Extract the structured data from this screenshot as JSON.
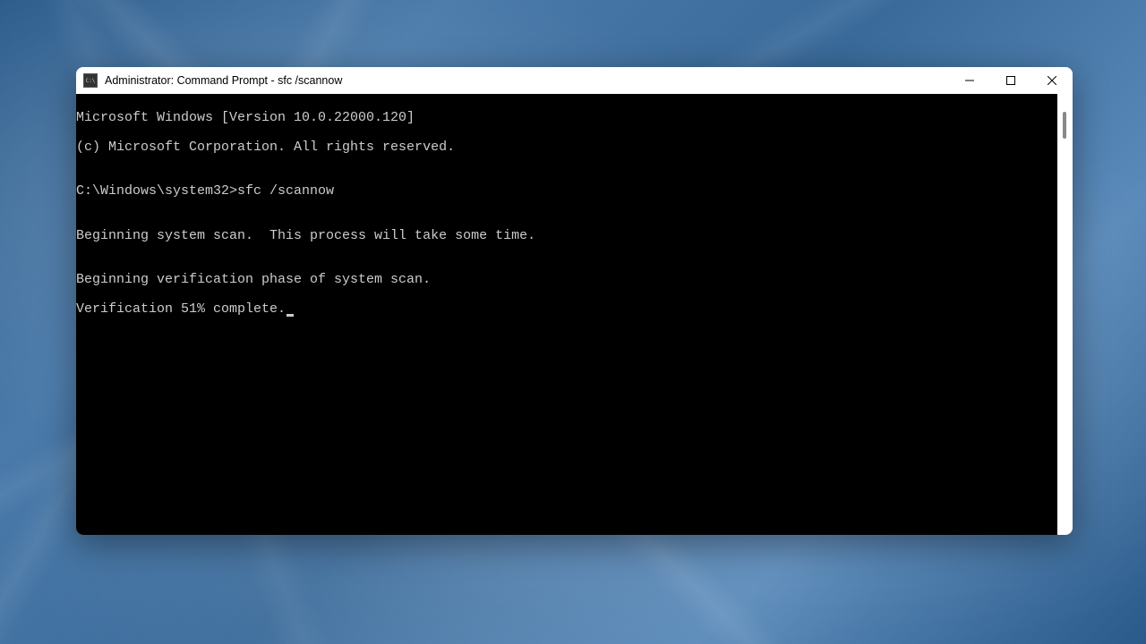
{
  "window": {
    "title": "Administrator: Command Prompt - sfc /scannow"
  },
  "terminal": {
    "lines": [
      "Microsoft Windows [Version 10.0.22000.120]",
      "(c) Microsoft Corporation. All rights reserved.",
      "",
      "C:\\Windows\\system32>sfc /scannow",
      "",
      "Beginning system scan.  This process will take some time.",
      "",
      "Beginning verification phase of system scan.",
      "Verification 51% complete."
    ],
    "prompt": "C:\\Windows\\system32>",
    "command": "sfc /scannow",
    "progress_percent": 51
  }
}
